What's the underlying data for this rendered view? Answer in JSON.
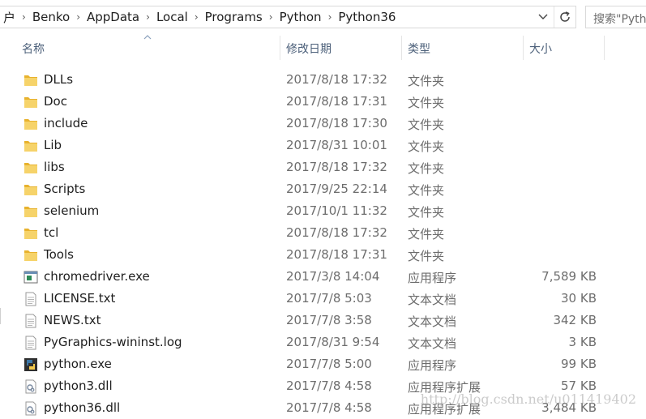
{
  "breadcrumb": {
    "items": [
      "户",
      "Benko",
      "AppData",
      "Local",
      "Programs",
      "Python",
      "Python36"
    ]
  },
  "search": {
    "placeholder": "搜索\"Pyth"
  },
  "columns": {
    "name": "名称",
    "date": "修改日期",
    "type": "类型",
    "size": "大小"
  },
  "files": [
    {
      "name": "DLLs",
      "date": "2017/8/18 17:32",
      "type": "文件夹",
      "size": "",
      "icon": "folder-icon"
    },
    {
      "name": "Doc",
      "date": "2017/8/18 17:31",
      "type": "文件夹",
      "size": "",
      "icon": "folder-icon"
    },
    {
      "name": "include",
      "date": "2017/8/18 17:30",
      "type": "文件夹",
      "size": "",
      "icon": "folder-icon"
    },
    {
      "name": "Lib",
      "date": "2017/8/31 10:01",
      "type": "文件夹",
      "size": "",
      "icon": "folder-icon"
    },
    {
      "name": "libs",
      "date": "2017/8/18 17:32",
      "type": "文件夹",
      "size": "",
      "icon": "folder-icon"
    },
    {
      "name": "Scripts",
      "date": "2017/9/25 22:14",
      "type": "文件夹",
      "size": "",
      "icon": "folder-icon"
    },
    {
      "name": "selenium",
      "date": "2017/10/1 11:32",
      "type": "文件夹",
      "size": "",
      "icon": "folder-icon"
    },
    {
      "name": "tcl",
      "date": "2017/8/18 17:32",
      "type": "文件夹",
      "size": "",
      "icon": "folder-icon"
    },
    {
      "name": "Tools",
      "date": "2017/8/18 17:31",
      "type": "文件夹",
      "size": "",
      "icon": "folder-icon"
    },
    {
      "name": "chromedriver.exe",
      "date": "2017/3/8 14:04",
      "type": "应用程序",
      "size": "7,589 KB",
      "icon": "exe-icon"
    },
    {
      "name": "LICENSE.txt",
      "date": "2017/7/8 5:03",
      "type": "文本文档",
      "size": "30 KB",
      "icon": "text-file-icon"
    },
    {
      "name": "NEWS.txt",
      "date": "2017/7/8 3:58",
      "type": "文本文档",
      "size": "342 KB",
      "icon": "text-file-icon"
    },
    {
      "name": "PyGraphics-wininst.log",
      "date": "2017/8/31 9:54",
      "type": "文本文档",
      "size": "3 KB",
      "icon": "text-file-icon"
    },
    {
      "name": "python.exe",
      "date": "2017/7/8 5:00",
      "type": "应用程序",
      "size": "99 KB",
      "icon": "python-exe-icon"
    },
    {
      "name": "python3.dll",
      "date": "2017/7/8 4:58",
      "type": "应用程序扩展",
      "size": "57 KB",
      "icon": "dll-icon"
    },
    {
      "name": "python36.dll",
      "date": "2017/7/8 4:58",
      "type": "应用程序扩展",
      "size": "3,484 KB",
      "icon": "dll-icon"
    }
  ],
  "watermark": "http://blog.csdn.net/u011419402",
  "colors": {
    "folder": "#f3c63f",
    "header_text": "#4c607a",
    "detail_text": "#6d6d6d"
  }
}
